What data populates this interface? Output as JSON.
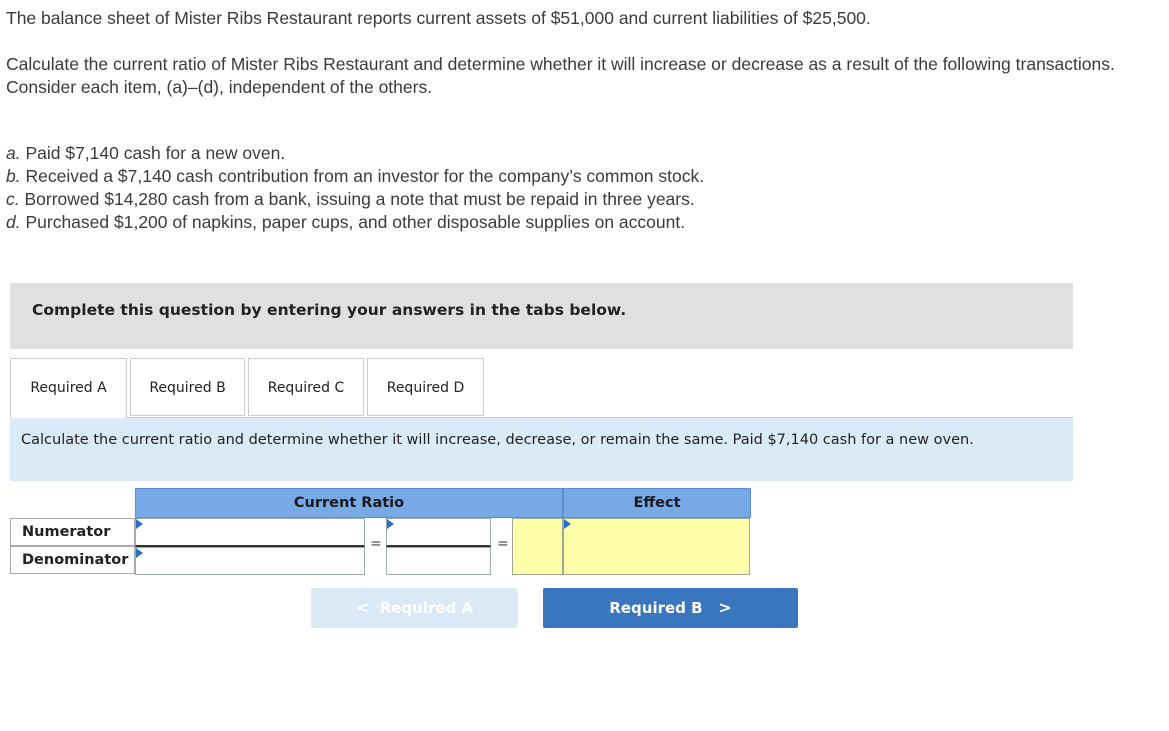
{
  "intro": {
    "line1": "The balance sheet of Mister Ribs Restaurant reports current assets of $51,000 and current liabilities of $25,500.",
    "line2": "Calculate the current ratio of Mister Ribs Restaurant and determine whether it will increase or decrease as a result of the following transactions. Consider each item, (a)–(d), independent of the others."
  },
  "items": [
    {
      "letter": "a.",
      "text": " Paid $7,140 cash for a new oven."
    },
    {
      "letter": "b.",
      "text": " Received a $7,140 cash contribution from an investor for the company’s common stock."
    },
    {
      "letter": "c.",
      "text": " Borrowed $14,280 cash from a bank, issuing a note that must be repaid in three years."
    },
    {
      "letter": "d.",
      "text": " Purchased $1,200 of napkins, paper cups, and other disposable supplies on account."
    }
  ],
  "banner": "Complete this question by entering your answers in the tabs below.",
  "tabs": [
    "Required A",
    "Required B",
    "Required C",
    "Required D"
  ],
  "instruction": "Calculate the current ratio and determine whether it will increase, decrease, or remain the same. Paid $7,140 cash for a new oven.",
  "table": {
    "header_ratio": "Current Ratio",
    "header_effect": "Effect",
    "row_numerator": "Numerator",
    "row_denominator": "Denominator",
    "eq": "="
  },
  "nav": {
    "prev_label": "Required A",
    "next_label": "Required B",
    "prev_chevron": "<",
    "next_chevron": ">"
  },
  "colors": {
    "header_blue": "#76a9e6",
    "instruction_bg": "#dbeaf7",
    "result_yellow": "#ffffaa",
    "next_button": "#3a76be"
  }
}
